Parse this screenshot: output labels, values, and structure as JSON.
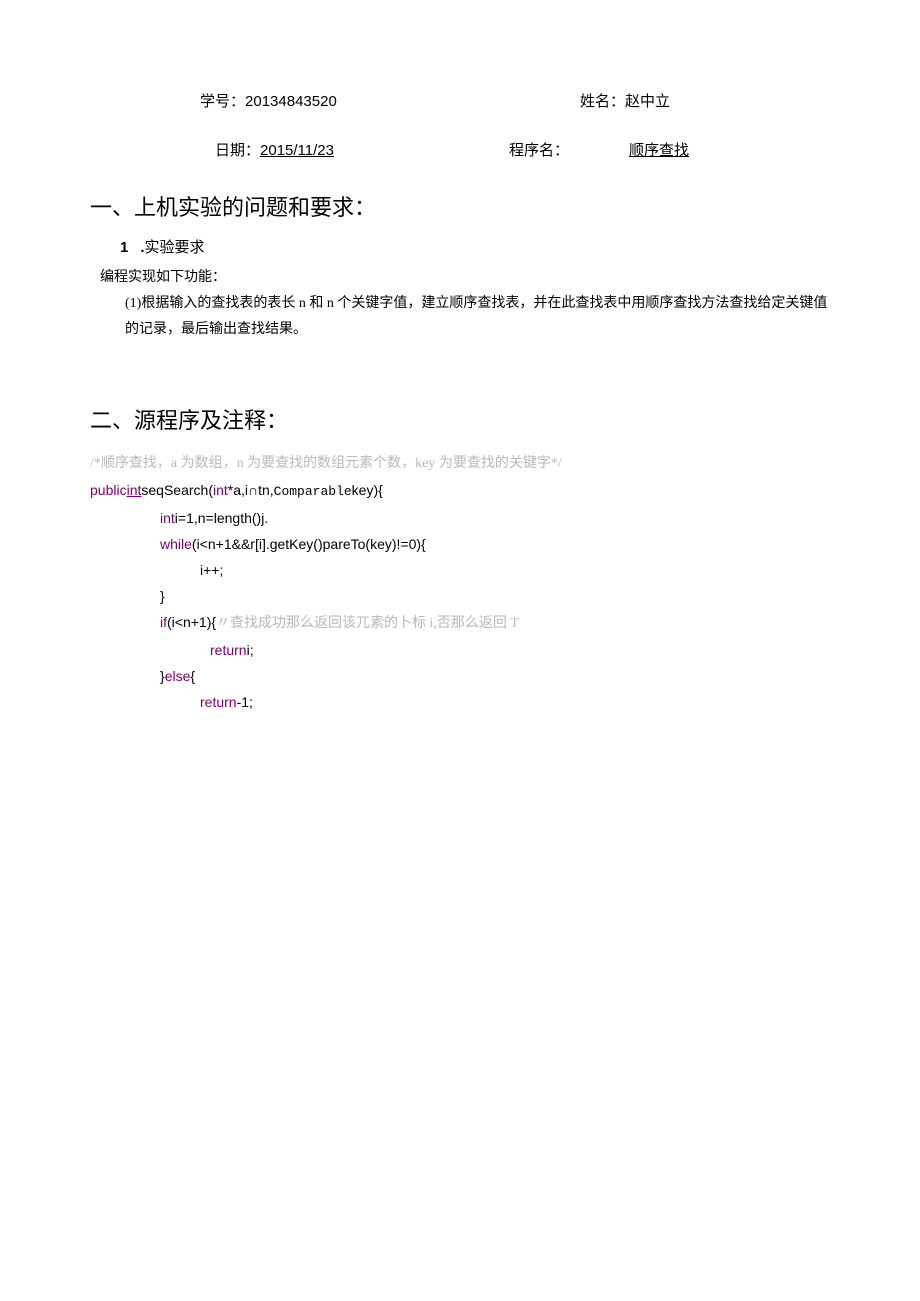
{
  "header": {
    "student_id_label": "学号：",
    "student_id": "20134843520",
    "name_label": "姓名：",
    "name": "赵中立",
    "date_label": "日期：",
    "date": "2015/11/23",
    "program_label": "程序名：",
    "program": "顺序查找"
  },
  "section1": {
    "title": "一、上机实验的问题和要求：",
    "sub_num": "1",
    "sub_dot": ".",
    "sub_text": "实验要求",
    "line1": "编程实现如下功能：",
    "line2": "(1)根据输入的查找表的表长 n 和 n 个关键字值，建立顺序查找表，并在此查找表中用顺序查找方法查找给定关键值的记录，最后输出查找结果。"
  },
  "section2": {
    "title": "二、源程序及注释："
  },
  "code": {
    "l0_a": "/*顺序查找，a 为数组，n 为要查找的数组元素个数，key 为要查找的关键字*/",
    "l1_public": "public",
    "l1_int": "int",
    "l1_a": "seqSearch(",
    "l1_int2": "int",
    "l1_b": "*a,i∩tn,",
    "l1_comp": "Comparable",
    "l1_c": "key){",
    "l2_int": "int",
    "l2_a": "i=1,n=length()j.",
    "l3_while": "while",
    "l3_a": "(i<n+1&&r[i].getKey()pareTo(key)!=0){",
    "l4_a": "i++;",
    "l5_a": "}",
    "l6_if": "if",
    "l6_a": "(i<n+1){",
    "l6_cmt": "〃查找成功那么返回该兀素的卜标 i,否那么返回 T",
    "l7_return": "return",
    "l7_a": "i;",
    "l8_a": "}",
    "l8_else": "else",
    "l8_b": "{",
    "l9_return": "return",
    "l9_a": "-1;"
  }
}
